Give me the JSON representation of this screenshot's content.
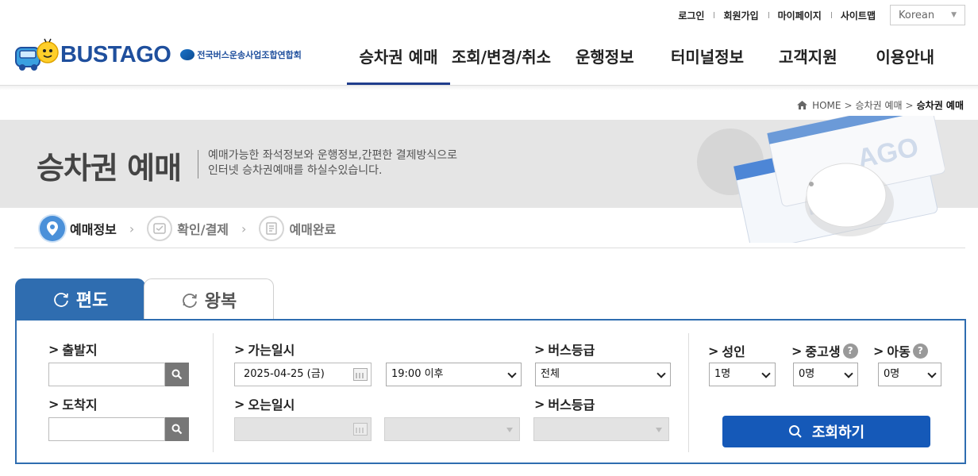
{
  "util": {
    "login": "로그인",
    "join": "회원가입",
    "mypage": "마이페이지",
    "sitemap": "사이트맵",
    "language": "Korean"
  },
  "brand": {
    "logo_text": "BUSTAGO",
    "association": "전국버스운송사업조합연합회"
  },
  "gnb": [
    {
      "label": "승차권 예매",
      "active": true
    },
    {
      "label": "조회/변경/취소"
    },
    {
      "label": "운행정보"
    },
    {
      "label": "터미널정보"
    },
    {
      "label": "고객지원"
    },
    {
      "label": "이용안내"
    }
  ],
  "breadcrumb": {
    "home": "HOME",
    "level1": "승차권 예매",
    "current": "승차권 예매"
  },
  "banner": {
    "title": "승차권 예매",
    "desc_line1": "예매가능한 좌석정보와 운행정보,간편한 결제방식으로",
    "desc_line2": "인터넷 승차권예매를 하실수있습니다."
  },
  "steps": [
    {
      "label": "예매정보",
      "icon": "location-pin-icon",
      "active": true
    },
    {
      "label": "확인/결제",
      "icon": "payment-icon",
      "active": false
    },
    {
      "label": "예매완료",
      "icon": "document-icon",
      "active": false
    }
  ],
  "tabs": {
    "oneway": "편도",
    "roundtrip": "왕복"
  },
  "form": {
    "departure_label": "출발지",
    "departure_value": "",
    "arrival_label": "도착지",
    "arrival_value": "",
    "go_date_label": "가는일시",
    "go_date_value": "2025-04-25 (금)",
    "go_time_value": "19:00 이후",
    "bus_grade_label": "버스등급",
    "bus_grade_value": "전체",
    "return_date_label": "오는일시",
    "return_date_value": "",
    "return_bus_grade_label": "버스등급",
    "adult_label": "성인",
    "adult_value": "1명",
    "youth_label": "중고생",
    "youth_value": "0명",
    "child_label": "아동",
    "child_value": "0명",
    "help_glyph": "?",
    "search_button": "조회하기"
  },
  "colors": {
    "primary": "#2f6db0",
    "nav_active": "#1f3d8c",
    "search_button": "#1559b8",
    "banner_bg": "#e5e5e5"
  }
}
